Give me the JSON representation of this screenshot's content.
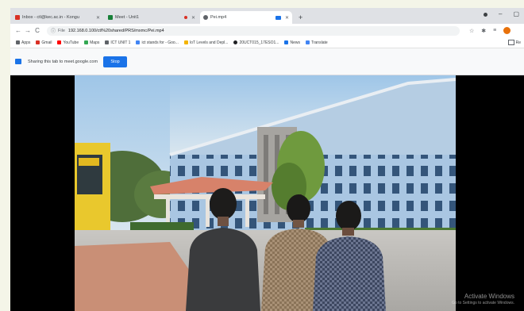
{
  "tabs": [
    {
      "title": "Inbox - ctl@kec.ac.in - Kongu",
      "favicon_color": "#d93025",
      "active": false
    },
    {
      "title": "Meet - Unit1",
      "favicon_color": "#188038",
      "active": false
    },
    {
      "title": "Pei.mp4",
      "favicon_color": "#5f6368",
      "active": true
    }
  ],
  "new_tab": "+",
  "toolbar": {
    "back": "←",
    "forward": "→",
    "reload": "C",
    "scheme": "File",
    "url": "192.168.0.100/ctl%20shared/PRS/mxmc/Pei.mp4"
  },
  "bookmarks": [
    {
      "label": "Apps",
      "icon_color": "#5f6368"
    },
    {
      "label": "Gmail",
      "icon_color": "#d93025"
    },
    {
      "label": "YouTube",
      "icon_color": "#ff0000"
    },
    {
      "label": "Maps",
      "icon_color": "#34a853"
    },
    {
      "label": "ICT UNIT 1",
      "icon_color": "#5f6368"
    },
    {
      "label": "ict stands for - Goo...",
      "icon_color": "#4285f4"
    },
    {
      "label": "IoT Levels and Depl...",
      "icon_color": "#f4b400"
    },
    {
      "label": "20UCT015_17ESO1...",
      "icon_color": "#202124"
    },
    {
      "label": "News",
      "icon_color": "#1a73e8"
    },
    {
      "label": "Translate",
      "icon_color": "#4285f4"
    }
  ],
  "bookmarks_other": "Re",
  "sharing": {
    "text": "Sharing this tab to meet.google.com",
    "stop_label": "Stop"
  },
  "watermark": {
    "line1": "Activate Windows",
    "line2": "Go to Settings to activate Windows."
  }
}
